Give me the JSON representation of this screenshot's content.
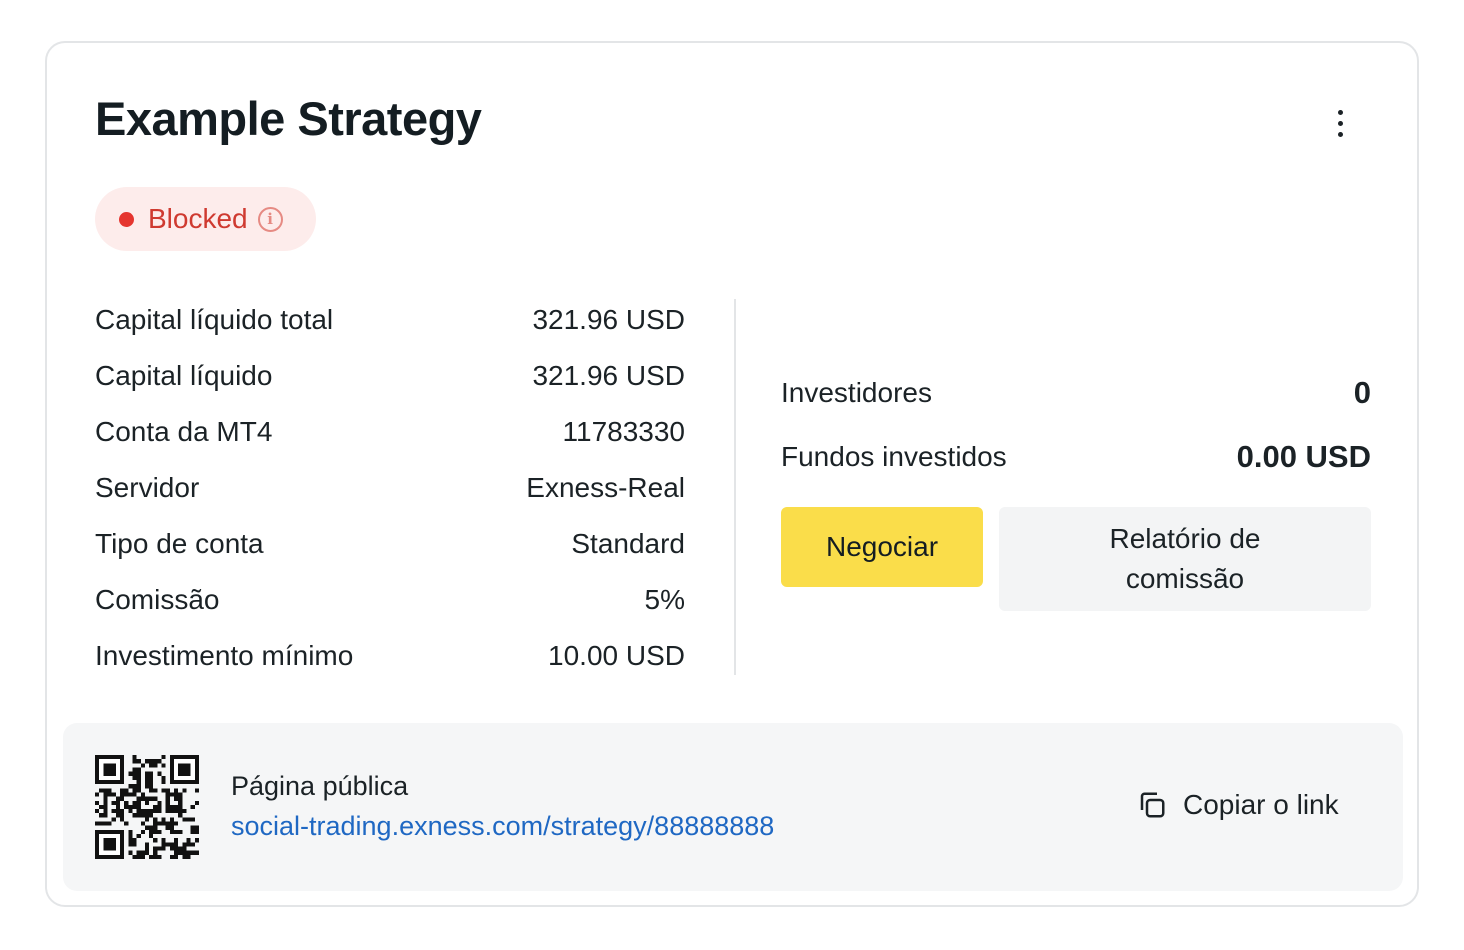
{
  "card": {
    "title": "Example Strategy",
    "more_icon": "more-vertical-icon",
    "status": {
      "label": "Blocked",
      "color": "#e5352f",
      "info_icon": "info-icon",
      "info_glyph": "i"
    }
  },
  "stats": [
    {
      "label": "Capital líquido total",
      "value": "321.96 USD"
    },
    {
      "label": "Capital líquido",
      "value": "321.96 USD"
    },
    {
      "label": "Conta da MT4",
      "value": "11783330"
    },
    {
      "label": "Servidor",
      "value": "Exness-Real"
    },
    {
      "label": "Tipo de conta",
      "value": "Standard"
    },
    {
      "label": "Comissão",
      "value": "5%"
    },
    {
      "label": "Investimento mínimo",
      "value": "10.00 USD"
    }
  ],
  "investors": {
    "label": "Investidores",
    "value": "0"
  },
  "invested_funds": {
    "label": "Fundos investidos",
    "value": "0.00 USD"
  },
  "buttons": {
    "trade": "Negociar",
    "commission_report": "Relatório de comissão",
    "trade_color": "#fadd4a"
  },
  "public_page": {
    "label": "Página pública",
    "link": "social-trading.exness.com/strategy/88888888",
    "copy_label": "Copiar o link",
    "qr_icon": "qr-code-icon",
    "copy_icon": "copy-icon",
    "link_color": "#1f68c3"
  }
}
